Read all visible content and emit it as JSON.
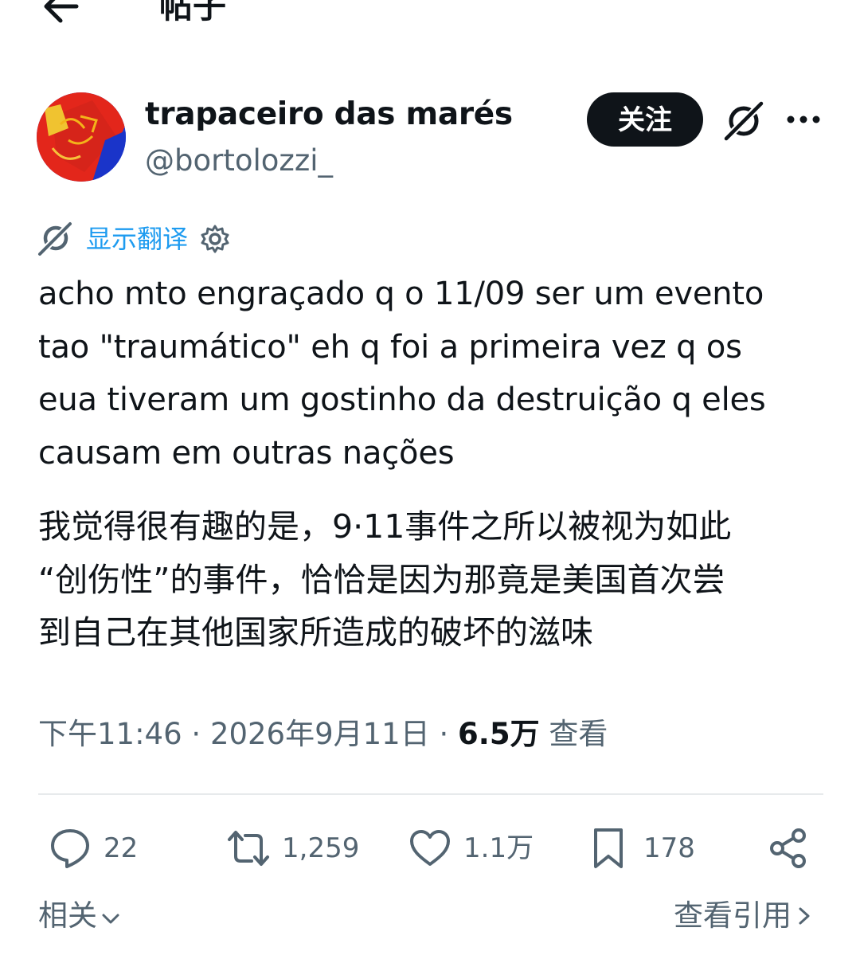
{
  "header": {
    "title": "帖子",
    "back_icon": "arrow-left-icon"
  },
  "author": {
    "display_name": "trapaceiro das marés",
    "handle": "@bortolozzi_",
    "follow_label": "关注"
  },
  "translate": {
    "label": "显示翻译"
  },
  "post": {
    "text": "acho mto engraçado q o 11/09 ser um evento\ntao \"traumático\" eh q foi a primeira vez q os\neua tiveram um gostinho da destruição q eles\ncausam em outras nações",
    "translation": "我觉得很有趣的是，9·11事件之所以被视为如此\n“创伤性”的事件，恰恰是因为那竟是美国首次尝\n到自己在其他国家所造成的破坏的滋味",
    "time": "下午11:46",
    "date": "2026年9月11日",
    "views_count": "6.5万",
    "views_label": "查看"
  },
  "actions": {
    "replies": "22",
    "reposts": "1,259",
    "likes": "1.1万",
    "bookmarks": "178"
  },
  "footer": {
    "related_label": "相关",
    "view_quotes_label": "查看引用"
  },
  "colors": {
    "text": "#0f1419",
    "secondary": "#536471",
    "link": "#1d9bf0",
    "follow_bg": "#0f1419",
    "divider": "#e7eaec"
  }
}
